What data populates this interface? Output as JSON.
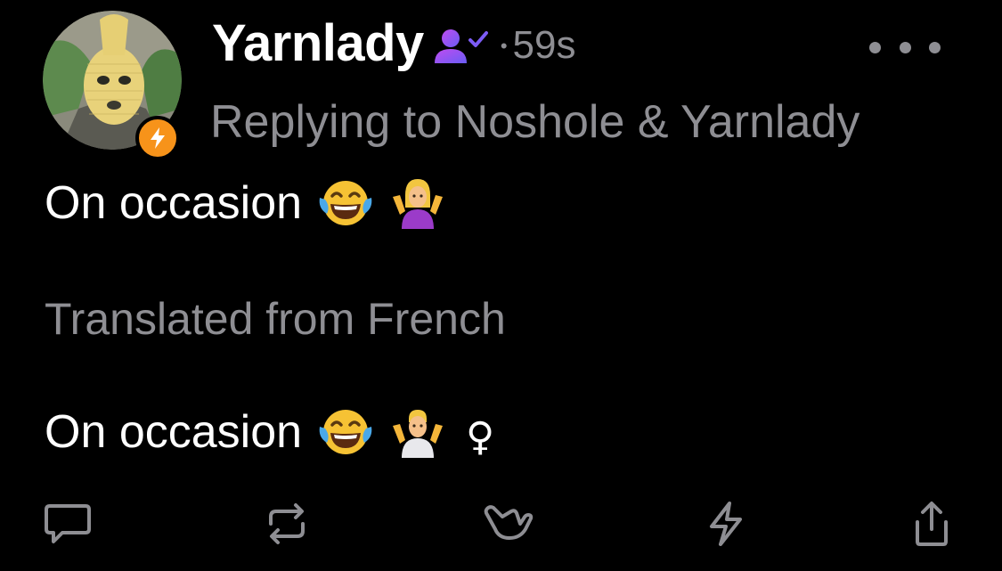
{
  "post": {
    "author_name": "Yarnlady",
    "dot": "•",
    "time": "59s",
    "reply_line": "Replying to Noshole & Yarnlady",
    "text": "On occasion",
    "translated_label": "Translated from French",
    "translated_text": "On occasion",
    "venus_symbol": "♀"
  },
  "icons": {
    "avatar": "avatar",
    "badge": "lightning-badge-icon",
    "verified": "user-check-icon",
    "more": "more-icon",
    "reply": "comment-icon",
    "repost": "repost-icon",
    "like": "shaka-hand-icon",
    "zap": "lightning-icon",
    "share": "share-icon"
  },
  "colors": {
    "background": "#000000",
    "text_primary": "#ffffff",
    "text_secondary": "#8e8e93",
    "badge_orange": "#f7931a",
    "verified_purple": "#a45cf5"
  }
}
